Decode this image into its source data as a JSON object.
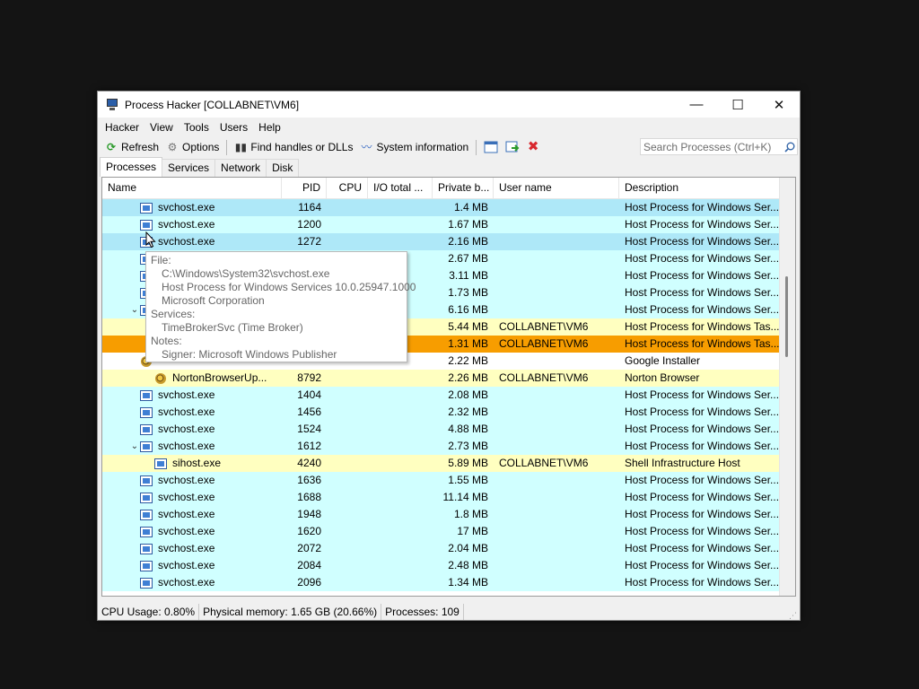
{
  "window": {
    "title": "Process Hacker [COLLABNET\\VM6]",
    "controls": {
      "minimize": "—",
      "maximize": "☐",
      "close": "✕"
    }
  },
  "menu": [
    "Hacker",
    "View",
    "Tools",
    "Users",
    "Help"
  ],
  "toolbar": {
    "refresh": "Refresh",
    "options": "Options",
    "find_handles": "Find handles or DLLs",
    "system_info": "System information",
    "search_placeholder": "Search Processes (Ctrl+K)"
  },
  "tabs": [
    "Processes",
    "Services",
    "Network",
    "Disk"
  ],
  "columns": [
    "Name",
    "PID",
    "CPU",
    "I/O total ...",
    "Private b...",
    "User name",
    "Description"
  ],
  "colors": {
    "service": "#d0ffff",
    "service_selected": "#aee8f8",
    "user_process": "#ffffc0",
    "highlight": "#f79d00",
    "plain": "#ffffff"
  },
  "rows": [
    {
      "name": "svchost.exe",
      "pid": "1164",
      "cpu": "",
      "io": "",
      "priv": "1.4 MB",
      "user": "",
      "desc": "Host Process for Windows Ser...",
      "style": "service_selected",
      "indent": 1,
      "expand": "",
      "icon": "service"
    },
    {
      "name": "svchost.exe",
      "pid": "1200",
      "cpu": "",
      "io": "",
      "priv": "1.67 MB",
      "user": "",
      "desc": "Host Process for Windows Ser...",
      "style": "service",
      "indent": 1,
      "expand": "",
      "icon": "service"
    },
    {
      "name": "svchost.exe",
      "pid": "1272",
      "cpu": "",
      "io": "",
      "priv": "2.16 MB",
      "user": "",
      "desc": "Host Process for Windows Ser...",
      "style": "service_selected",
      "indent": 1,
      "expand": "",
      "icon": "service"
    },
    {
      "name": "",
      "pid": "",
      "cpu": "",
      "io": "",
      "priv": "2.67 MB",
      "user": "",
      "desc": "Host Process for Windows Ser...",
      "style": "service",
      "indent": 1,
      "expand": "",
      "icon": "service"
    },
    {
      "name": "",
      "pid": "",
      "cpu": "",
      "io": "",
      "priv": "3.11 MB",
      "user": "",
      "desc": "Host Process for Windows Ser...",
      "style": "service",
      "indent": 1,
      "expand": "",
      "icon": "service"
    },
    {
      "name": "",
      "pid": "",
      "cpu": "",
      "io": "",
      "priv": "1.73 MB",
      "user": "",
      "desc": "Host Process for Windows Ser...",
      "style": "service",
      "indent": 1,
      "expand": "",
      "icon": "service"
    },
    {
      "name": "",
      "pid": "",
      "cpu": "",
      "io": "",
      "priv": "6.16 MB",
      "user": "",
      "desc": "Host Process for Windows Ser...",
      "style": "service",
      "indent": 1,
      "expand": "⌄",
      "icon": "service"
    },
    {
      "name": "",
      "pid": "",
      "cpu": "",
      "io": "",
      "priv": "5.44 MB",
      "user": "COLLABNET\\VM6",
      "desc": "Host Process for Windows Tas...",
      "style": "user_process",
      "indent": 2,
      "expand": "",
      "icon": "service"
    },
    {
      "name": "",
      "pid": "",
      "cpu": "",
      "io": "",
      "priv": "1.31 MB",
      "user": "COLLABNET\\VM6",
      "desc": "Host Process for Windows Tas...",
      "style": "highlight",
      "indent": 2,
      "expand": "",
      "icon": "service"
    },
    {
      "name": "",
      "pid": "",
      "cpu": "",
      "io": "",
      "priv": "2.22 MB",
      "user": "",
      "desc": "Google Installer",
      "style": "plain",
      "indent": 1,
      "expand": "",
      "icon": "gear"
    },
    {
      "name": "NortonBrowserUp...",
      "pid": "8792",
      "cpu": "",
      "io": "",
      "priv": "2.26 MB",
      "user": "COLLABNET\\VM6",
      "desc": "Norton Browser",
      "style": "user_process",
      "indent": 2,
      "expand": "",
      "icon": "gear"
    },
    {
      "name": "svchost.exe",
      "pid": "1404",
      "cpu": "",
      "io": "",
      "priv": "2.08 MB",
      "user": "",
      "desc": "Host Process for Windows Ser...",
      "style": "service",
      "indent": 1,
      "expand": "",
      "icon": "service"
    },
    {
      "name": "svchost.exe",
      "pid": "1456",
      "cpu": "",
      "io": "",
      "priv": "2.32 MB",
      "user": "",
      "desc": "Host Process for Windows Ser...",
      "style": "service",
      "indent": 1,
      "expand": "",
      "icon": "service"
    },
    {
      "name": "svchost.exe",
      "pid": "1524",
      "cpu": "",
      "io": "",
      "priv": "4.88 MB",
      "user": "",
      "desc": "Host Process for Windows Ser...",
      "style": "service",
      "indent": 1,
      "expand": "",
      "icon": "service"
    },
    {
      "name": "svchost.exe",
      "pid": "1612",
      "cpu": "",
      "io": "",
      "priv": "2.73 MB",
      "user": "",
      "desc": "Host Process for Windows Ser...",
      "style": "service",
      "indent": 1,
      "expand": "⌄",
      "icon": "service"
    },
    {
      "name": "sihost.exe",
      "pid": "4240",
      "cpu": "",
      "io": "",
      "priv": "5.89 MB",
      "user": "COLLABNET\\VM6",
      "desc": "Shell Infrastructure Host",
      "style": "user_process",
      "indent": 2,
      "expand": "",
      "icon": "service"
    },
    {
      "name": "svchost.exe",
      "pid": "1636",
      "cpu": "",
      "io": "",
      "priv": "1.55 MB",
      "user": "",
      "desc": "Host Process for Windows Ser...",
      "style": "service",
      "indent": 1,
      "expand": "",
      "icon": "service"
    },
    {
      "name": "svchost.exe",
      "pid": "1688",
      "cpu": "",
      "io": "",
      "priv": "11.14 MB",
      "user": "",
      "desc": "Host Process for Windows Ser...",
      "style": "service",
      "indent": 1,
      "expand": "",
      "icon": "service"
    },
    {
      "name": "svchost.exe",
      "pid": "1948",
      "cpu": "",
      "io": "",
      "priv": "1.8 MB",
      "user": "",
      "desc": "Host Process for Windows Ser...",
      "style": "service",
      "indent": 1,
      "expand": "",
      "icon": "service"
    },
    {
      "name": "svchost.exe",
      "pid": "1620",
      "cpu": "",
      "io": "",
      "priv": "17 MB",
      "user": "",
      "desc": "Host Process for Windows Ser...",
      "style": "service",
      "indent": 1,
      "expand": "",
      "icon": "service"
    },
    {
      "name": "svchost.exe",
      "pid": "2072",
      "cpu": "",
      "io": "",
      "priv": "2.04 MB",
      "user": "",
      "desc": "Host Process for Windows Ser...",
      "style": "service",
      "indent": 1,
      "expand": "",
      "icon": "service"
    },
    {
      "name": "svchost.exe",
      "pid": "2084",
      "cpu": "",
      "io": "",
      "priv": "2.48 MB",
      "user": "",
      "desc": "Host Process for Windows Ser...",
      "style": "service",
      "indent": 1,
      "expand": "",
      "icon": "service"
    },
    {
      "name": "svchost.exe",
      "pid": "2096",
      "cpu": "",
      "io": "",
      "priv": "1.34 MB",
      "user": "",
      "desc": "Host Process for Windows Ser...",
      "style": "service",
      "indent": 1,
      "expand": "",
      "icon": "service"
    }
  ],
  "tooltip": {
    "file_label": "File:",
    "file_path": "C:\\Windows\\System32\\svchost.exe",
    "file_desc": "Host Process for Windows Services 10.0.25947.1000",
    "company": "Microsoft Corporation",
    "services_label": "Services:",
    "service": "TimeBrokerSvc (Time Broker)",
    "notes_label": "Notes:",
    "signer": "Signer: Microsoft Windows Publisher"
  },
  "status": {
    "cpu": "CPU Usage: 0.80%",
    "memory": "Physical memory: 1.65 GB (20.66%)",
    "processes": "Processes: 109"
  }
}
